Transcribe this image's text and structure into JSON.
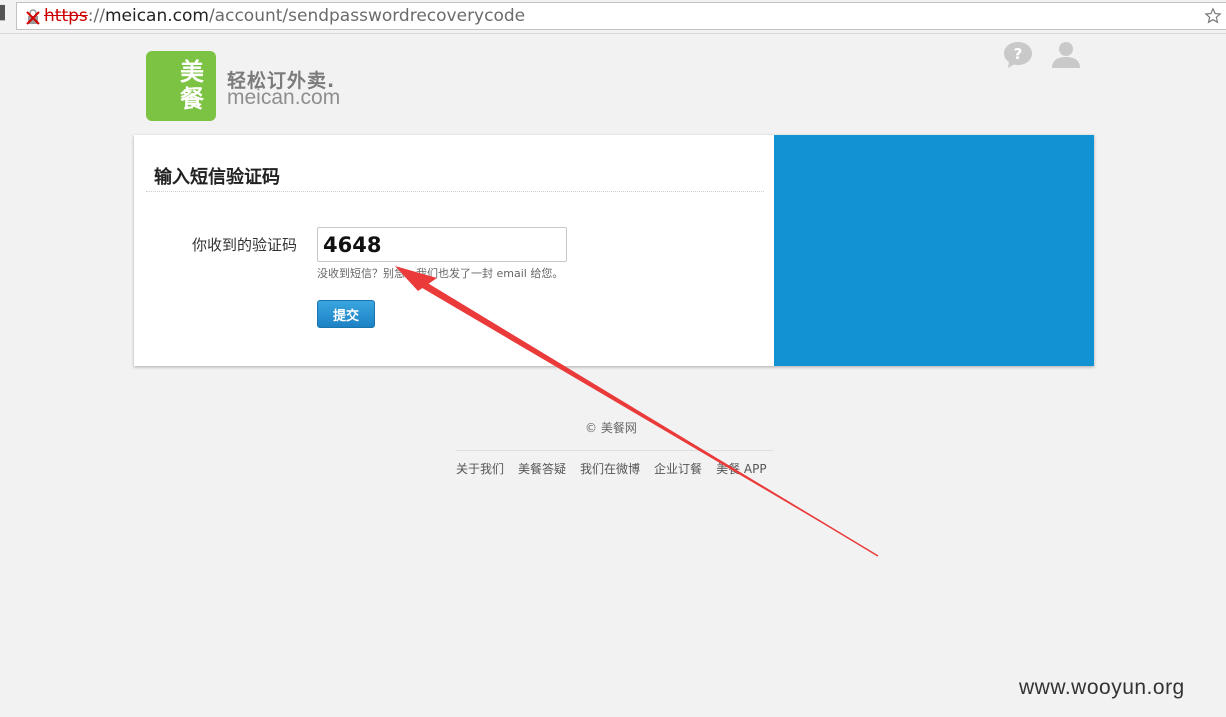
{
  "browser": {
    "url_scheme": "https",
    "url_sep": "://",
    "url_host": "meican.com",
    "url_path": "/account/sendpasswordrecoverycode"
  },
  "header": {
    "logo_char_1": "美",
    "logo_char_2": "餐",
    "tagline": "轻松订外卖.",
    "domain": "meican.com",
    "logo_color": "#7cc243"
  },
  "form": {
    "title": "输入短信验证码",
    "label": "你收到的验证码",
    "code_value": "4648",
    "hint": "没收到短信？别急，我们也发了一封 email 给您。",
    "submit_label": "提交",
    "accent_color": "#1292d2"
  },
  "footer": {
    "copyright": "© 美餐网",
    "links": [
      "关于我们",
      "美餐答疑",
      "我们在微博",
      "企业订餐",
      "美餐 APP"
    ]
  },
  "watermark": "www.wooyun.org"
}
